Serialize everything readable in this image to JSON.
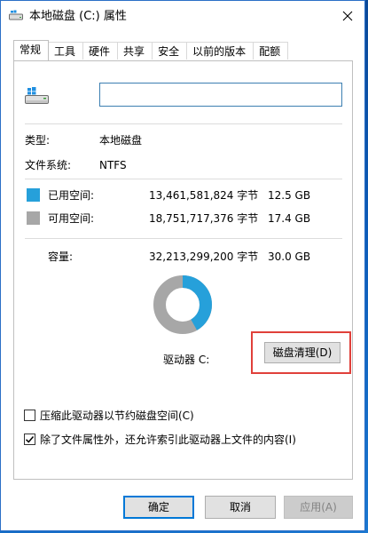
{
  "window": {
    "title": "本地磁盘 (C:) 属性",
    "accent_color": "#0078d7"
  },
  "tabs": [
    "常规",
    "工具",
    "硬件",
    "共享",
    "安全",
    "以前的版本",
    "配额"
  ],
  "general": {
    "volume_name_value": "",
    "type_label": "类型:",
    "type_value": "本地磁盘",
    "fs_label": "文件系统:",
    "fs_value": "NTFS",
    "used": {
      "label": "已用空间:",
      "bytes": "13,461,581,824 字节",
      "size": "12.5 GB",
      "color": "#26a0da"
    },
    "free": {
      "label": "可用空间:",
      "bytes": "18,751,717,376 字节",
      "size": "17.4 GB",
      "color": "#a7a7a7"
    },
    "capacity": {
      "label": "容量:",
      "bytes": "32,213,299,200 字节",
      "size": "30.0 GB"
    },
    "used_fraction": 0.4179,
    "drive_label": "驱动器 C:",
    "cleanup_button": "磁盘清理(D)"
  },
  "options": {
    "compress_label": "压缩此驱动器以节约磁盘空间(C)",
    "compress_checked": false,
    "index_label": "除了文件属性外，还允许索引此驱动器上文件的内容(I)",
    "index_checked": true
  },
  "buttons": {
    "ok": "确定",
    "cancel": "取消",
    "apply": "应用(A)"
  }
}
